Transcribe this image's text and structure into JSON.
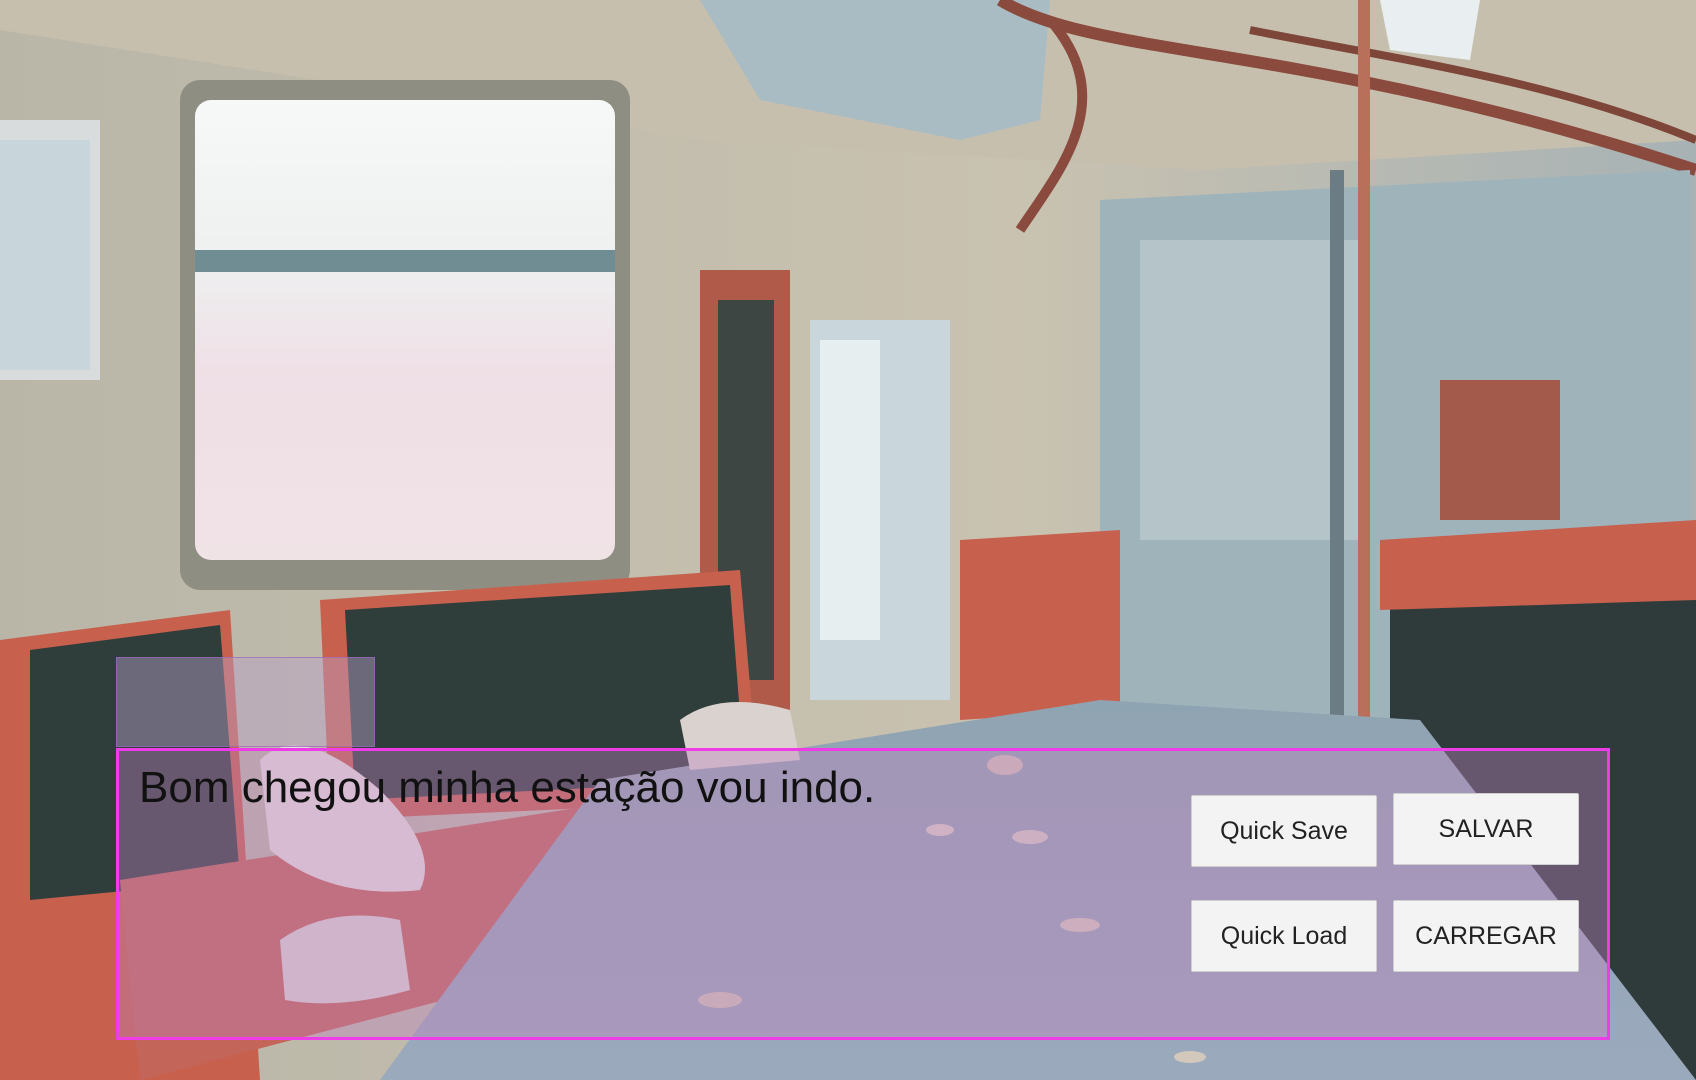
{
  "dialogue": {
    "text": "Bom chegou minha estação vou indo."
  },
  "buttons": {
    "quick_save": "Quick Save",
    "save": "SALVAR",
    "quick_load": "Quick Load",
    "load": "CARREGAR"
  },
  "colors": {
    "dialog_border": "#f03ce8",
    "button_bg": "#f3f3f3"
  }
}
